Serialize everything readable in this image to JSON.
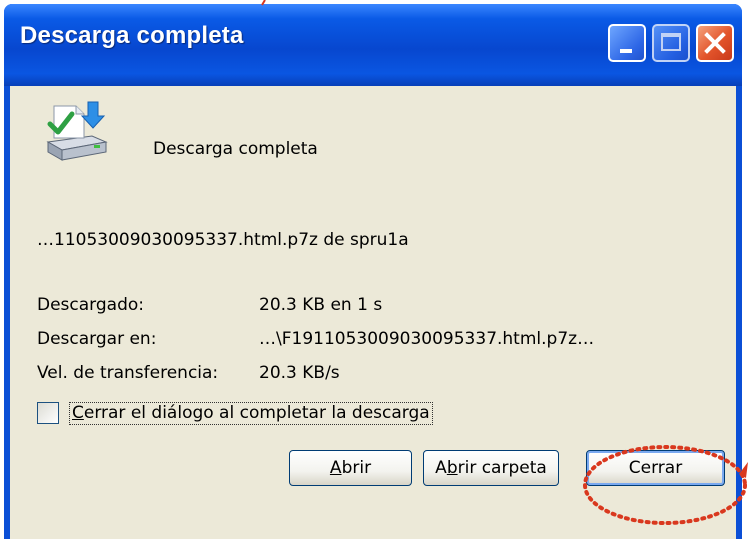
{
  "window": {
    "title": "Descarga completa",
    "controls": [
      "minimize-icon",
      "maximize-icon",
      "close-icon"
    ]
  },
  "header": {
    "icon": "download-complete-icon",
    "text": "Descarga completa"
  },
  "file": {
    "name": "…11053009030095337.html.p7z de spru1a"
  },
  "details": [
    {
      "label": "Descargado:",
      "value": "20.3 KB en 1 s"
    },
    {
      "label": "Descargar en:",
      "value": "…\\F1911053009030095337.html.p7z…"
    },
    {
      "label": "Vel. de transferencia:",
      "value": "20.3 KB/s"
    }
  ],
  "checkbox": {
    "label_accel": "C",
    "label_rest": "errar el diálogo al completar la descarga",
    "checked": false
  },
  "buttons": {
    "open": {
      "accel": "A",
      "rest": "brir"
    },
    "open_folder": {
      "pre": "A",
      "accel": "b",
      "rest": "rir carpeta"
    },
    "close": {
      "label": "Cerrar"
    }
  },
  "colors": {
    "titlebar": "#0a5ae6",
    "dialog_bg": "#ece9d8",
    "close_button": "#e2542b",
    "annotation": "#d9381e"
  }
}
